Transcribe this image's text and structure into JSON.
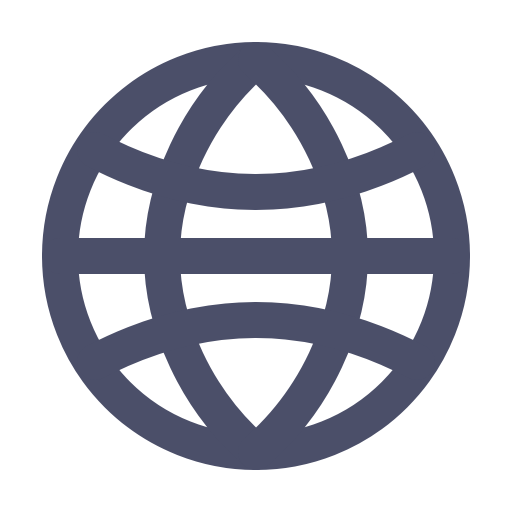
{
  "icon": {
    "name": "globe-icon",
    "color": "#4b4f69",
    "background": "#ffffff"
  }
}
